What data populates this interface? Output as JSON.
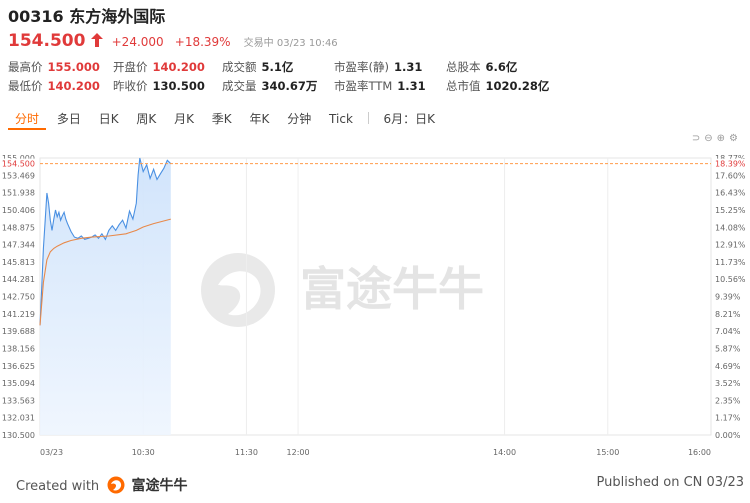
{
  "stock": {
    "code_name": "00316 东方海外国际",
    "price": "154.500",
    "change": "+24.000",
    "change_pct": "+18.39%",
    "status": "交易中 03/23 10:46"
  },
  "stats": {
    "high_label": "最高价",
    "high_value": "155.000",
    "low_label": "最低价",
    "low_value": "140.200",
    "open_label": "开盘价",
    "open_value": "140.200",
    "prev_close_label": "昨收价",
    "prev_close_value": "130.500",
    "turnover_label": "成交额",
    "turnover_value": "5.1亿",
    "volume_label": "成交量",
    "volume_value": "340.67万",
    "pe_static_label": "市盈率(静)",
    "pe_static_value": "1.31",
    "pe_ttm_label": "市盈率TTM",
    "pe_ttm_value": "1.31",
    "shares_label": "总股本",
    "shares_value": "6.6亿",
    "mcap_label": "总市值",
    "mcap_value": "1020.28亿"
  },
  "tabs": [
    "分时",
    "多日",
    "日K",
    "周K",
    "月K",
    "季K",
    "年K",
    "分钟",
    "Tick",
    "6月：日K"
  ],
  "watermark": "富途牛牛",
  "footer": {
    "created_with": "Created with",
    "brand": "富途牛牛",
    "published": "Published on CN 03/23"
  },
  "colors": {
    "up": "#e03a3a",
    "accent": "#ff6a00",
    "price_line": "#4a90e2",
    "avg_line": "#e8894a"
  },
  "chart_data": {
    "type": "area",
    "y_left_ticks": [
      "155.000",
      "153.469",
      "151.938",
      "150.406",
      "148.875",
      "147.344",
      "145.813",
      "144.281",
      "142.750",
      "141.219",
      "139.688",
      "138.156",
      "136.625",
      "135.094",
      "133.563",
      "132.031",
      "130.500"
    ],
    "y_right_ticks": [
      "18.77%",
      "17.60%",
      "16.43%",
      "15.25%",
      "14.08%",
      "12.91%",
      "11.73%",
      "10.56%",
      "9.39%",
      "8.21%",
      "7.04%",
      "5.87%",
      "4.69%",
      "3.52%",
      "2.35%",
      "1.17%",
      "0.00%"
    ],
    "current_price_label": "154.500",
    "current_pct_label": "18.39%",
    "x_ticks": [
      "03/23",
      "10:30",
      "11:30",
      "12:00",
      "14:00",
      "15:00",
      "16:00"
    ],
    "x_tick_minutes": [
      0,
      60,
      120,
      150,
      270,
      330,
      390
    ],
    "x_range_minutes": [
      0,
      390
    ],
    "ylim": [
      130.5,
      155.0
    ],
    "price_series": {
      "x": [
        0,
        1,
        2,
        3,
        4,
        5,
        6,
        7,
        8,
        9,
        10,
        11,
        12,
        13,
        14,
        15,
        16,
        18,
        20,
        22,
        24,
        26,
        28,
        30,
        32,
        34,
        36,
        38,
        40,
        42,
        44,
        46,
        48,
        50,
        52,
        54,
        56,
        57,
        58,
        60,
        62,
        64,
        66,
        68,
        70,
        72,
        74,
        76
      ],
      "y": [
        140.2,
        143.5,
        147.0,
        149.5,
        151.9,
        151.0,
        149.5,
        148.6,
        149.6,
        150.4,
        149.8,
        150.2,
        149.5,
        149.9,
        150.2,
        149.6,
        149.2,
        148.5,
        148.0,
        147.9,
        148.1,
        147.8,
        147.9,
        148.0,
        148.2,
        147.9,
        148.3,
        147.8,
        148.6,
        149.0,
        148.6,
        149.1,
        149.5,
        148.8,
        150.3,
        149.6,
        151.0,
        153.5,
        155.0,
        153.8,
        154.4,
        153.2,
        154.0,
        153.1,
        153.6,
        154.1,
        154.8,
        154.5
      ]
    },
    "avg_series": {
      "x": [
        0,
        2,
        4,
        6,
        8,
        10,
        14,
        18,
        24,
        30,
        40,
        50,
        56,
        60,
        66,
        76
      ],
      "y": [
        140.2,
        144.0,
        146.0,
        146.7,
        147.0,
        147.2,
        147.5,
        147.7,
        147.9,
        148.0,
        148.1,
        148.3,
        148.6,
        148.9,
        149.2,
        149.6
      ]
    }
  }
}
